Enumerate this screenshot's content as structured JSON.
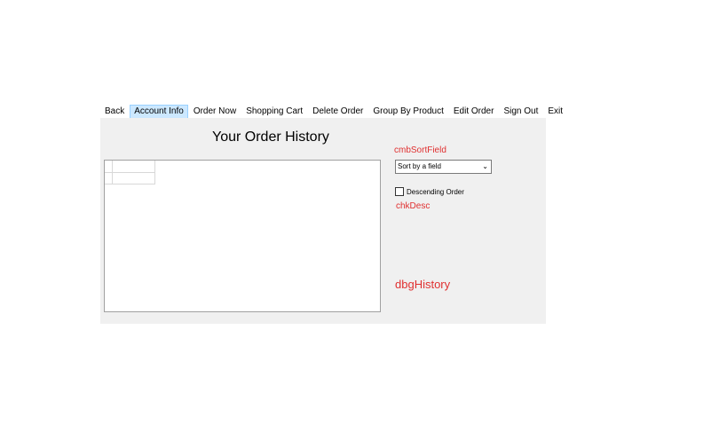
{
  "menu": {
    "items": [
      {
        "label": "Back"
      },
      {
        "label": "Account Info"
      },
      {
        "label": "Order Now"
      },
      {
        "label": "Shopping Cart"
      },
      {
        "label": "Delete Order"
      },
      {
        "label": "Group By Product"
      },
      {
        "label": "Edit Order"
      },
      {
        "label": "Sign Out"
      },
      {
        "label": "Exit"
      }
    ],
    "active_item": "Account Info"
  },
  "form": {
    "title": "Your Order History",
    "sort_combo": {
      "selected": "Sort by a field",
      "design_name": "cmbSortField"
    },
    "descending_checkbox": {
      "label": "Descending Order",
      "checked": false,
      "design_name": "chkDesc"
    },
    "history_grid": {
      "design_name": "dbgHistory"
    }
  },
  "colors": {
    "form_background": "#f0f0f0",
    "design_label": "#e03030",
    "menu_highlight": "#cce8ff"
  }
}
